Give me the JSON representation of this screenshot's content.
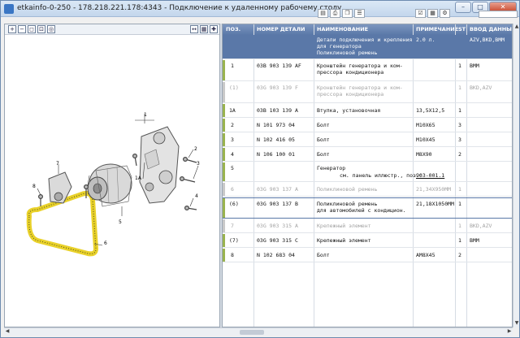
{
  "window": {
    "title": "etkainfo-0-250 - 178.218.221.178:4343 - Подключение к удаленному рабочему столу",
    "minimize": "–",
    "maximize": "□",
    "close": "✕"
  },
  "icons": [
    "zoom-in-icon",
    "zoom-out-icon",
    "zoom-fit-icon",
    "zoom-window-icon",
    "page-icon",
    "print-icon",
    "copy-icon",
    "settings-icon"
  ],
  "table": {
    "columns": [
      "ПОЗ.",
      "НОМЕР ДЕТАЛИ",
      "НАИМЕНОВАНИЕ",
      "ПРИМЕЧАНИЕ",
      "ST",
      "ВВОД ДАННЫХ"
    ],
    "header_row": {
      "name": "Детали подключения и крепления\nдля генератора\nПоликлиновой ремень",
      "note": "2.0 л.",
      "data": "AZV,BKD,BMM"
    },
    "rows": [
      {
        "pos": "1",
        "part": "03B 903 139 AF",
        "name": "Кронштейн генератора и ком-\nпрессора кондиционера",
        "note": "",
        "st": "1",
        "data": "BMM",
        "gray": false
      },
      {
        "pos": "(1)",
        "part": "03G 903 139 F",
        "name": "Кронштейн генератора и ком-\nпрессора кондиционера",
        "note": "",
        "st": "1",
        "data": "BKD,AZV",
        "gray": true
      },
      {
        "pos": "1A",
        "part": "03B 103 139 A",
        "name": "Втулка, установочная",
        "note": "13,5X12,5",
        "st": "1",
        "data": "",
        "gray": false
      },
      {
        "pos": "2",
        "part": "N 101 973 04",
        "name": "Болт",
        "note": "M10X65",
        "st": "3",
        "data": "",
        "gray": false
      },
      {
        "pos": "3",
        "part": "N 102 416 05",
        "name": "Болт",
        "note": "M10X45",
        "st": "3",
        "data": "",
        "gray": false
      },
      {
        "pos": "4",
        "part": "N 106 100 01",
        "name": "Болт",
        "note": "M8X90",
        "st": "2",
        "data": "",
        "gray": false
      },
      {
        "pos": "5",
        "part": "",
        "name": "Генератор",
        "subnote": "см. панель иллюстр., поз.:",
        "link": "903-001.1",
        "note": "",
        "st": "",
        "data": "",
        "gray": false
      },
      {
        "pos": "6",
        "part": "03G 903 137 A",
        "name": "Поликлиновой ремень",
        "note": "21,34X950MM",
        "st": "1",
        "data": "",
        "gray": true
      },
      {
        "pos": "(6)",
        "part": "03G 903 137 B",
        "name": "Поликлиновой ремень\nдля автомобилей с кондицион.",
        "note": "21,18X1050MM",
        "st": "1",
        "data": "",
        "gray": false
      },
      {
        "pos": "7",
        "part": "03G 903 315 A",
        "name": "Крепежный элемент",
        "note": "",
        "st": "1",
        "data": "BKD,AZV",
        "gray": true
      },
      {
        "pos": "(7)",
        "part": "03G 903 315 C",
        "name": "Крепежный элемент",
        "note": "",
        "st": "1",
        "data": "BMM",
        "gray": false
      },
      {
        "pos": "8",
        "part": "N 102 683 04",
        "name": "Болт",
        "note": "AM8X45",
        "st": "2",
        "data": "",
        "gray": false
      }
    ]
  },
  "drawing": {
    "callouts": [
      "1",
      "1A",
      "2",
      "3",
      "4",
      "5",
      "6",
      "7",
      "8"
    ]
  }
}
